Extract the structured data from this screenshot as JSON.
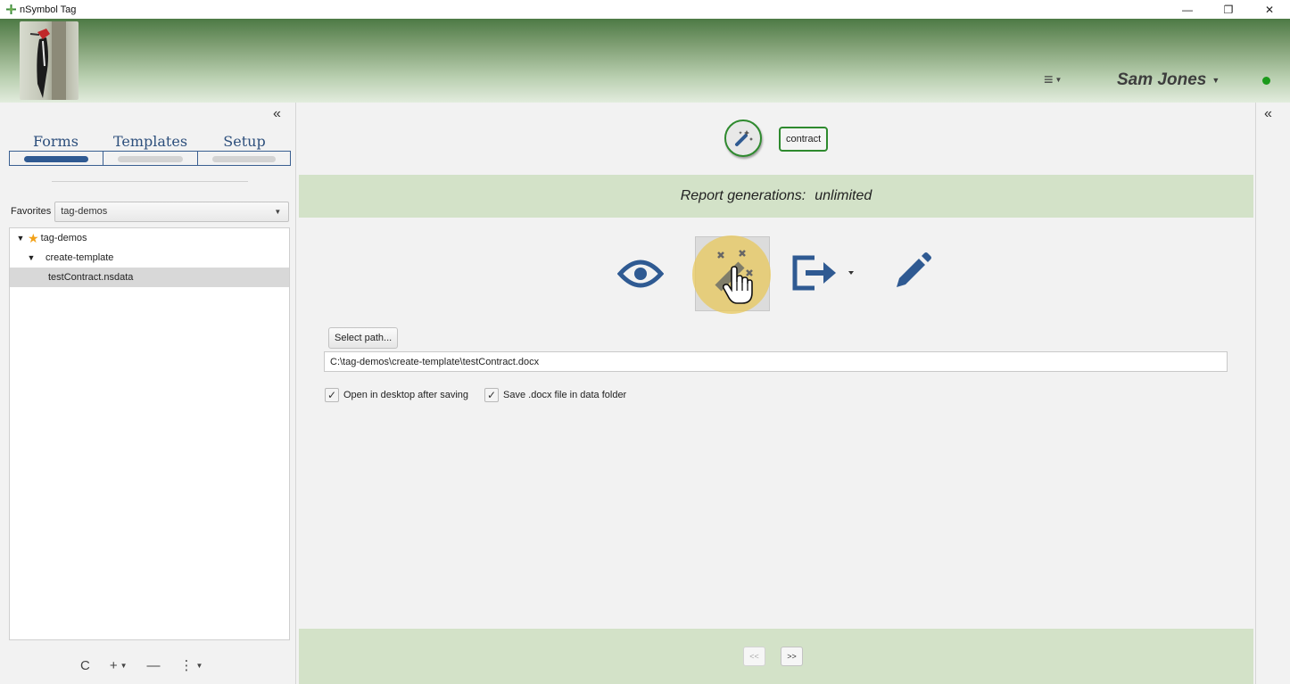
{
  "window": {
    "title": "nSymbol Tag",
    "controls": {
      "minimize": "—",
      "restore": "❐",
      "close": "✕"
    }
  },
  "header": {
    "menu_icon": "≡",
    "user_name": "Sam Jones",
    "status_color": "#1b9a1b"
  },
  "sidebar": {
    "collapse_glyph": "«",
    "tabs": [
      {
        "label": "Forms",
        "active": true
      },
      {
        "label": "Templates",
        "active": false
      },
      {
        "label": "Setup",
        "active": false
      }
    ],
    "favorites_label": "Favorites",
    "favorites_value": "tag-demos",
    "tree": [
      {
        "label": "tag-demos",
        "level": 0,
        "expanded": true,
        "starred": true
      },
      {
        "label": "create-template",
        "level": 1,
        "expanded": true
      },
      {
        "label": "testContract.nsdata",
        "level": 2,
        "selected": true
      }
    ],
    "toolbar": {
      "refresh": "C",
      "add": "+",
      "remove": "—",
      "more": "⋮"
    }
  },
  "main": {
    "template_tag": "contract",
    "report_label": "Report generations:",
    "report_value": "unlimited",
    "select_path_label": "Select path...",
    "path_value": "C:\\tag-demos\\create-template\\testContract.docx",
    "checkbox_open_label": "Open in desktop after saving",
    "checkbox_save_label": "Save .docx file in data folder",
    "prev_label": "<<",
    "next_label": ">>",
    "accent_color": "#2f5a92",
    "green_accent": "#2e8a2e"
  },
  "right_panel": {
    "collapse_glyph": "«"
  }
}
